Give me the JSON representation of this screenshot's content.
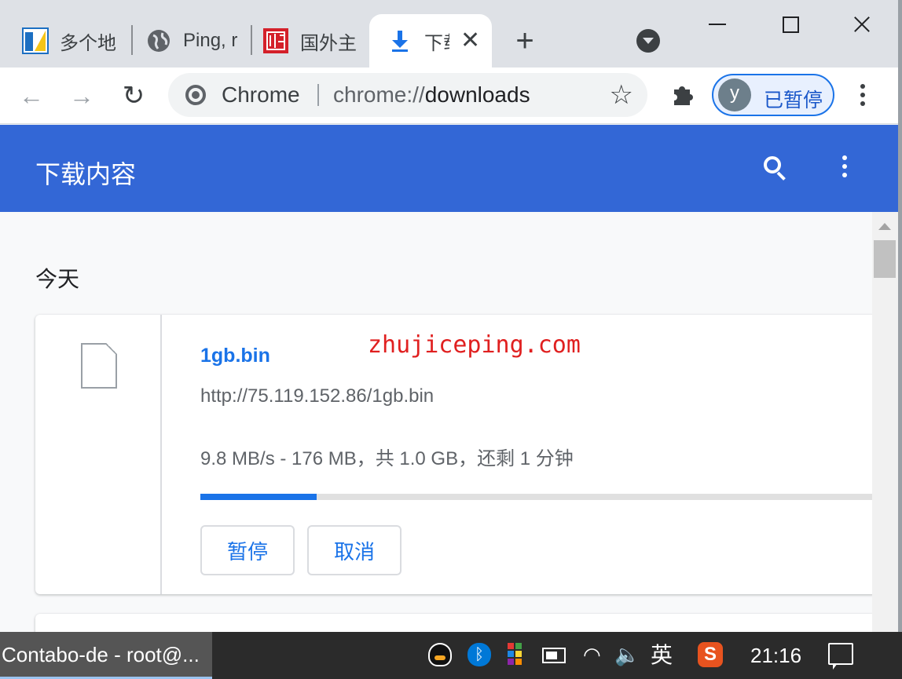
{
  "tabs": [
    {
      "title": "多个地",
      "icon": "site-favicon-yellow-blue"
    },
    {
      "title": "Ping, r",
      "icon": "globe-icon"
    },
    {
      "title": "国外主",
      "icon": "seal-favicon-red"
    },
    {
      "title": "下载",
      "icon": "download-icon",
      "active": true
    }
  ],
  "toolbar": {
    "omnibox_chip": "Chrome",
    "url_scheme": "chrome://",
    "url_path": "downloads",
    "profile_initial": "y",
    "profile_label": "已暂停"
  },
  "downloads": {
    "header_title": "下载内容",
    "date_heading": "今天",
    "item": {
      "file_name": "1gb.bin",
      "url": "http://75.119.152.86/1gb.bin",
      "status": "9.8 MB/s - 176 MB，共 1.0 GB，还剩 1 分钟",
      "progress_fraction": 0.172,
      "pause_label": "暂停",
      "cancel_label": "取消"
    }
  },
  "watermark": "zhujiceping.com",
  "taskbar": {
    "active_window": "Contabo-de - root@...",
    "ime_label": "英",
    "clock": "21:16"
  },
  "colors": {
    "header_blue": "#3367d6",
    "accent_blue": "#1a73e8",
    "watermark_red": "#e02020"
  }
}
